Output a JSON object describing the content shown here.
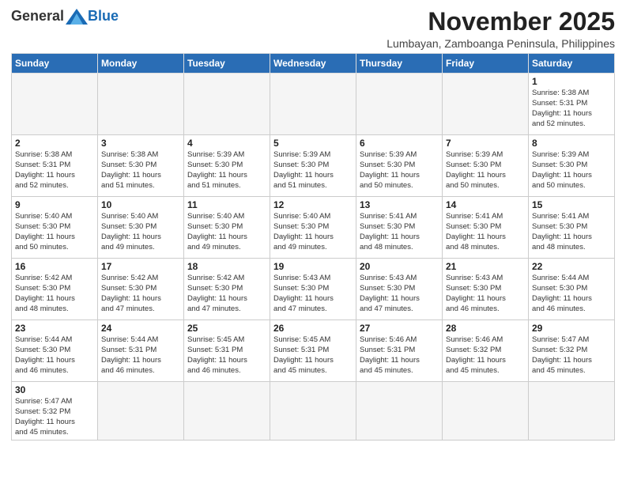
{
  "logo": {
    "general": "General",
    "blue": "Blue"
  },
  "title": {
    "month": "November 2025",
    "location": "Lumbayan, Zamboanga Peninsula, Philippines"
  },
  "headers": [
    "Sunday",
    "Monday",
    "Tuesday",
    "Wednesday",
    "Thursday",
    "Friday",
    "Saturday"
  ],
  "weeks": [
    [
      {
        "day": "",
        "text": ""
      },
      {
        "day": "",
        "text": ""
      },
      {
        "day": "",
        "text": ""
      },
      {
        "day": "",
        "text": ""
      },
      {
        "day": "",
        "text": ""
      },
      {
        "day": "",
        "text": ""
      },
      {
        "day": "1",
        "text": "Sunrise: 5:38 AM\nSunset: 5:31 PM\nDaylight: 11 hours\nand 52 minutes."
      }
    ],
    [
      {
        "day": "2",
        "text": "Sunrise: 5:38 AM\nSunset: 5:31 PM\nDaylight: 11 hours\nand 52 minutes."
      },
      {
        "day": "3",
        "text": "Sunrise: 5:38 AM\nSunset: 5:30 PM\nDaylight: 11 hours\nand 51 minutes."
      },
      {
        "day": "4",
        "text": "Sunrise: 5:39 AM\nSunset: 5:30 PM\nDaylight: 11 hours\nand 51 minutes."
      },
      {
        "day": "5",
        "text": "Sunrise: 5:39 AM\nSunset: 5:30 PM\nDaylight: 11 hours\nand 51 minutes."
      },
      {
        "day": "6",
        "text": "Sunrise: 5:39 AM\nSunset: 5:30 PM\nDaylight: 11 hours\nand 50 minutes."
      },
      {
        "day": "7",
        "text": "Sunrise: 5:39 AM\nSunset: 5:30 PM\nDaylight: 11 hours\nand 50 minutes."
      },
      {
        "day": "8",
        "text": "Sunrise: 5:39 AM\nSunset: 5:30 PM\nDaylight: 11 hours\nand 50 minutes."
      }
    ],
    [
      {
        "day": "9",
        "text": "Sunrise: 5:40 AM\nSunset: 5:30 PM\nDaylight: 11 hours\nand 50 minutes."
      },
      {
        "day": "10",
        "text": "Sunrise: 5:40 AM\nSunset: 5:30 PM\nDaylight: 11 hours\nand 49 minutes."
      },
      {
        "day": "11",
        "text": "Sunrise: 5:40 AM\nSunset: 5:30 PM\nDaylight: 11 hours\nand 49 minutes."
      },
      {
        "day": "12",
        "text": "Sunrise: 5:40 AM\nSunset: 5:30 PM\nDaylight: 11 hours\nand 49 minutes."
      },
      {
        "day": "13",
        "text": "Sunrise: 5:41 AM\nSunset: 5:30 PM\nDaylight: 11 hours\nand 48 minutes."
      },
      {
        "day": "14",
        "text": "Sunrise: 5:41 AM\nSunset: 5:30 PM\nDaylight: 11 hours\nand 48 minutes."
      },
      {
        "day": "15",
        "text": "Sunrise: 5:41 AM\nSunset: 5:30 PM\nDaylight: 11 hours\nand 48 minutes."
      }
    ],
    [
      {
        "day": "16",
        "text": "Sunrise: 5:42 AM\nSunset: 5:30 PM\nDaylight: 11 hours\nand 48 minutes."
      },
      {
        "day": "17",
        "text": "Sunrise: 5:42 AM\nSunset: 5:30 PM\nDaylight: 11 hours\nand 47 minutes."
      },
      {
        "day": "18",
        "text": "Sunrise: 5:42 AM\nSunset: 5:30 PM\nDaylight: 11 hours\nand 47 minutes."
      },
      {
        "day": "19",
        "text": "Sunrise: 5:43 AM\nSunset: 5:30 PM\nDaylight: 11 hours\nand 47 minutes."
      },
      {
        "day": "20",
        "text": "Sunrise: 5:43 AM\nSunset: 5:30 PM\nDaylight: 11 hours\nand 47 minutes."
      },
      {
        "day": "21",
        "text": "Sunrise: 5:43 AM\nSunset: 5:30 PM\nDaylight: 11 hours\nand 46 minutes."
      },
      {
        "day": "22",
        "text": "Sunrise: 5:44 AM\nSunset: 5:30 PM\nDaylight: 11 hours\nand 46 minutes."
      }
    ],
    [
      {
        "day": "23",
        "text": "Sunrise: 5:44 AM\nSunset: 5:30 PM\nDaylight: 11 hours\nand 46 minutes."
      },
      {
        "day": "24",
        "text": "Sunrise: 5:44 AM\nSunset: 5:31 PM\nDaylight: 11 hours\nand 46 minutes."
      },
      {
        "day": "25",
        "text": "Sunrise: 5:45 AM\nSunset: 5:31 PM\nDaylight: 11 hours\nand 46 minutes."
      },
      {
        "day": "26",
        "text": "Sunrise: 5:45 AM\nSunset: 5:31 PM\nDaylight: 11 hours\nand 45 minutes."
      },
      {
        "day": "27",
        "text": "Sunrise: 5:46 AM\nSunset: 5:31 PM\nDaylight: 11 hours\nand 45 minutes."
      },
      {
        "day": "28",
        "text": "Sunrise: 5:46 AM\nSunset: 5:32 PM\nDaylight: 11 hours\nand 45 minutes."
      },
      {
        "day": "29",
        "text": "Sunrise: 5:47 AM\nSunset: 5:32 PM\nDaylight: 11 hours\nand 45 minutes."
      }
    ],
    [
      {
        "day": "30",
        "text": "Sunrise: 5:47 AM\nSunset: 5:32 PM\nDaylight: 11 hours\nand 45 minutes."
      },
      {
        "day": "",
        "text": ""
      },
      {
        "day": "",
        "text": ""
      },
      {
        "day": "",
        "text": ""
      },
      {
        "day": "",
        "text": ""
      },
      {
        "day": "",
        "text": ""
      },
      {
        "day": "",
        "text": ""
      }
    ]
  ]
}
